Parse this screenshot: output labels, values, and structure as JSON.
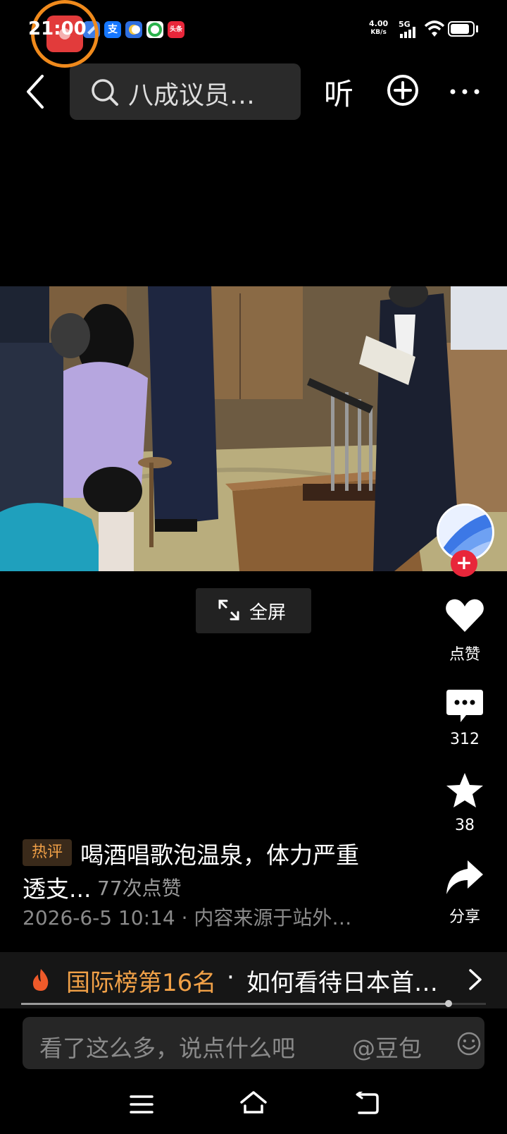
{
  "status_bar": {
    "time": "21:00",
    "net_speed_value": "4.00",
    "net_speed_unit": "KB/s",
    "network_type": "5G",
    "app_icons": [
      "blue-app-icon",
      "alipay-icon",
      "chat-app-icon",
      "green-swirl-icon",
      "toutiao-icon"
    ],
    "alipay_glyph": "支",
    "toutiao_glyph": "头条"
  },
  "top_nav": {
    "search_text": "八成议员…",
    "listen_label": "听"
  },
  "fullscreen": {
    "label": "全屏"
  },
  "right_rail": {
    "like_label": "点赞",
    "comment_count": "312",
    "favorite_count": "38",
    "share_label": "分享"
  },
  "hot_comment": {
    "tag": "热评",
    "text_line1": "喝酒唱歌泡温泉，体力严重",
    "text_line2": "透支...",
    "likes": "77次点赞",
    "meta": "2026-6-5 10:14 · 内容来源于站外…"
  },
  "ranking": {
    "rank": "国际榜第16名",
    "separator": "·",
    "title": "如何看待日本首…"
  },
  "playback": {
    "progress_fraction": 0.92
  },
  "comment_input": {
    "placeholder": "看了这么多，说点什么吧",
    "mention": "@豆包"
  },
  "colors": {
    "accent_orange": "#f0a047",
    "follow_red": "#e8263a",
    "record_ring": "#f08a1c"
  }
}
